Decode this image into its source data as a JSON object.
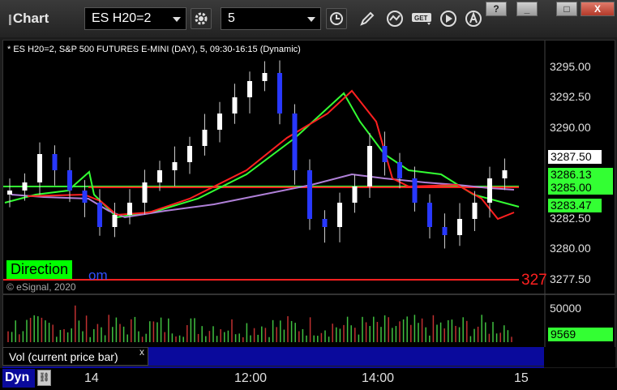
{
  "window": {
    "title": "Chart",
    "symbol": "ES H20=2",
    "interval": "5",
    "buttons": {
      "help": "?",
      "minimize": "_",
      "maximize": "□",
      "close": "X"
    }
  },
  "chart": {
    "title": "* ES H20=2, S&P 500 FUTURES E-MINI (DAY), 5, 09:30-16:15 (Dynamic)",
    "copyright": "© eSignal, 2020",
    "direction_label": "Direction",
    "watermark_partial": "om",
    "yaxis": [
      "3295.00",
      "3292.50",
      "3290.00",
      "3287.50",
      "3285.00",
      "3282.50",
      "3280.00",
      "3277.50"
    ],
    "badges": {
      "last_price": "3287.50",
      "green_top": "3286.13",
      "green_mid": "3285.00",
      "green_low": "3283.47",
      "red_level": "327"
    },
    "colors": {
      "up": "#ffffff",
      "down": "#2838ff",
      "ma_red": "#ff2020",
      "ma_green": "#33ff33",
      "ma_purple": "#b080d8",
      "hline": "#ff2020"
    }
  },
  "volume": {
    "label": "Vol (current price bar)",
    "close": "x",
    "yaxis": [
      "50000"
    ],
    "badge": "9569"
  },
  "xaxis": {
    "mode": "Dyn",
    "labels": [
      "14",
      "12:00",
      "14:00",
      "15"
    ]
  }
}
